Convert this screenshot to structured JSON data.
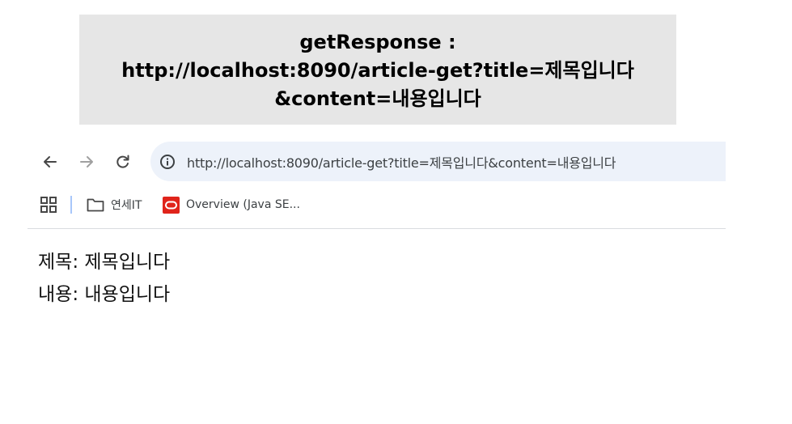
{
  "slide_title": {
    "line1": "getResponse :",
    "line2": "http://localhost:8090/article-get?title=제목입니다",
    "line3": "&content=내용입니다"
  },
  "browser": {
    "address_bar": {
      "url": "http://localhost:8090/article-get?title=제목입니다&content=내용입니다"
    },
    "bookmarks": [
      {
        "label": "연세IT",
        "icon": "folder-icon"
      },
      {
        "label": "Overview (Java SE...",
        "icon": "oracle-icon"
      }
    ]
  },
  "page": {
    "lines": [
      "제목: 제목입니다",
      "내용: 내용입니다"
    ]
  },
  "colors": {
    "title_box_bg": "#e6e6e6",
    "omnibox_bg": "#edf2fa",
    "oracle_red": "#e0241b",
    "bookmark_separator": "#a8c7fa"
  }
}
